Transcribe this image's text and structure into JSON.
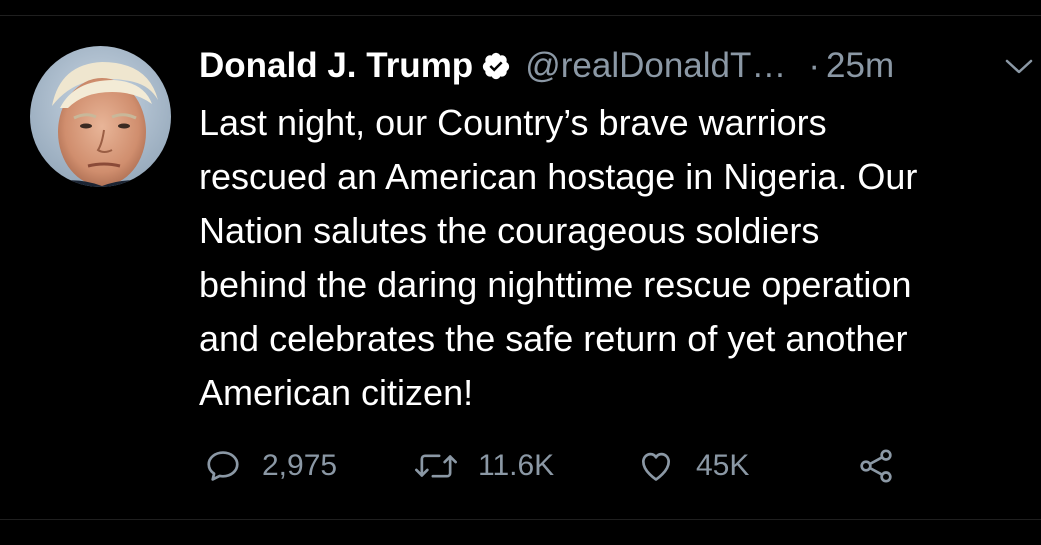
{
  "tweet": {
    "author": {
      "display_name": "Donald J. Trump",
      "handle": "@realDonaldT…",
      "verified": true
    },
    "separator": "·",
    "time_ago": "25m",
    "text_lines": [
      "Last night, our Country’s brave warriors",
      "rescued an American hostage in Nigeria. Our",
      "Nation salutes the courageous soldiers",
      "behind the daring nighttime rescue operation",
      "and celebrates the safe return of yet another",
      "American citizen!"
    ],
    "actions": {
      "replies": "2,975",
      "retweets": "11.6K",
      "likes": "45K"
    }
  },
  "icons": {
    "verified": "verified-badge-icon",
    "menu": "chevron-down-icon",
    "reply": "reply-icon",
    "retweet": "retweet-icon",
    "like": "heart-icon",
    "share": "share-icon"
  },
  "colors": {
    "background": "#000000",
    "text_primary": "#ffffff",
    "text_secondary": "#8b98a5",
    "verified_badge": "#ffffff"
  }
}
